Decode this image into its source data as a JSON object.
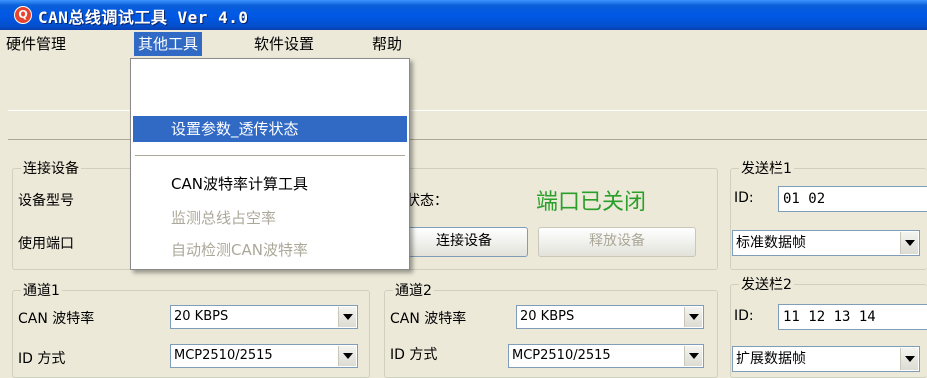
{
  "window": {
    "icon_letter": "Q",
    "title": "CAN总线调试工具 Ver 4.0"
  },
  "menubar": {
    "items": [
      {
        "label": "硬件管理"
      },
      {
        "label": "其他工具"
      },
      {
        "label": "软件设置"
      },
      {
        "label": "帮助"
      }
    ]
  },
  "dropdown": {
    "items": [
      {
        "label": "设置参数_透传状态"
      },
      {
        "label": "CAN波特率计算工具"
      },
      {
        "label": "监测总线占空率"
      },
      {
        "label": "自动检测CAN波特率"
      }
    ]
  },
  "connection": {
    "group_label": "连接设备",
    "device_model_label": "设备型号",
    "port_label": "使用端口",
    "status_label": "状态：",
    "status_value": "端口已关闭",
    "connect_button": "连接设备",
    "release_button": "释放设备"
  },
  "channel1": {
    "group_label": "通道1",
    "baud_label": "CAN 波特率",
    "baud_value": "20 KBPS",
    "id_mode_label": "ID 方式",
    "id_mode_value": "MCP2510/2515"
  },
  "channel2": {
    "group_label": "通道2",
    "baud_label": "CAN 波特率",
    "baud_value": "20 KBPS",
    "id_mode_label": "ID 方式",
    "id_mode_value": "MCP2510/2515"
  },
  "send1": {
    "group_label": "发送栏1",
    "id_label": "ID:",
    "id_value": "01 02",
    "frame_type": "标准数据帧"
  },
  "send2": {
    "group_label": "发送栏2",
    "id_label": "ID:",
    "id_value": "11 12 13 14",
    "frame_type": "扩展数据帧"
  },
  "colors": {
    "status_text": "#2a9f2a",
    "menu_highlight": "#316ac5",
    "titlebar": "#0058e6"
  }
}
